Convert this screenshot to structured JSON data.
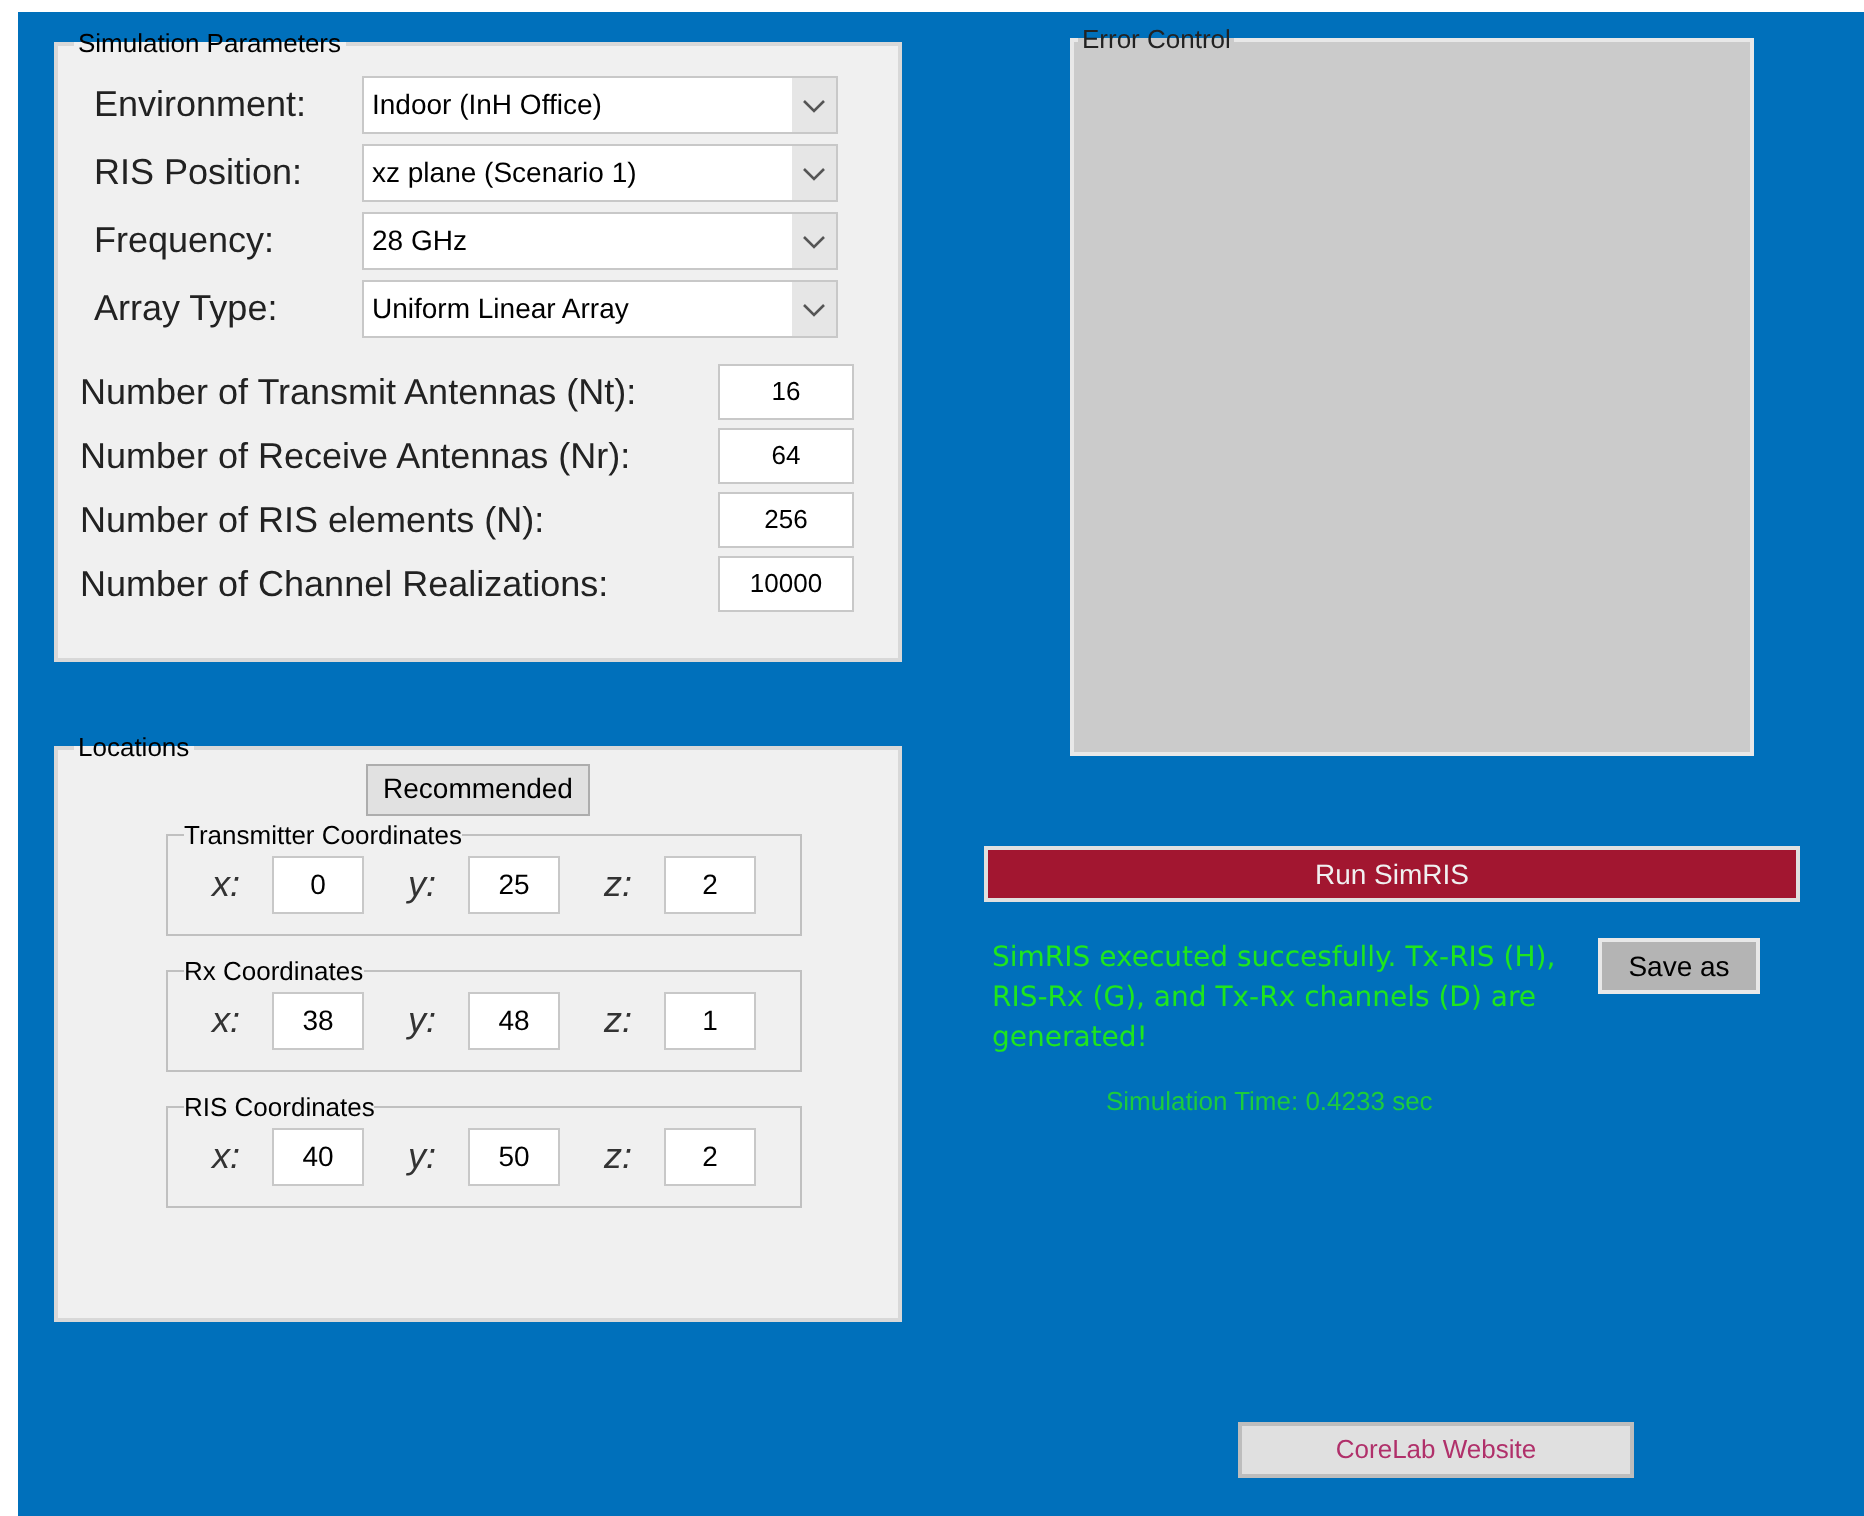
{
  "simulation_parameters": {
    "title": "Simulation Parameters",
    "dropdowns": [
      {
        "label": "Environment:",
        "value": "Indoor (InH Office)"
      },
      {
        "label": "RIS Position:",
        "value": "xz plane (Scenario 1)"
      },
      {
        "label": "Frequency:",
        "value": "28 GHz"
      },
      {
        "label": "Array Type:",
        "value": "Uniform Linear Array"
      }
    ],
    "numbers": [
      {
        "label": "Number of Transmit Antennas (Nt):",
        "value": "16"
      },
      {
        "label": "Number of Receive Antennas (Nr):",
        "value": "64"
      },
      {
        "label": "Number of RIS elements (N):",
        "value": "256"
      },
      {
        "label": "Number of Channel Realizations:",
        "value": "10000"
      }
    ]
  },
  "locations": {
    "title": "Locations",
    "recommended_button": "Recommended",
    "groups": [
      {
        "title": "Transmitter Coordinates",
        "coords": [
          {
            "axis": "x:",
            "value": "0"
          },
          {
            "axis": "y:",
            "value": "25"
          },
          {
            "axis": "z:",
            "value": "2"
          }
        ]
      },
      {
        "title": "Rx Coordinates",
        "coords": [
          {
            "axis": "x:",
            "value": "38"
          },
          {
            "axis": "y:",
            "value": "48"
          },
          {
            "axis": "z:",
            "value": "1"
          }
        ]
      },
      {
        "title": "RIS Coordinates",
        "coords": [
          {
            "axis": "x:",
            "value": "40"
          },
          {
            "axis": "y:",
            "value": "50"
          },
          {
            "axis": "z:",
            "value": "2"
          }
        ]
      }
    ]
  },
  "error_control": {
    "title": "Error Control"
  },
  "run_button": "Run SimRIS",
  "message": "SimRIS executed succesfully. Tx-RIS (H), RIS-Rx (G), and Tx-Rx channels (D) are generated!",
  "save_button": "Save as",
  "simulation_time": "Simulation Time: 0.4233 sec",
  "website_button": "CoreLab Website"
}
